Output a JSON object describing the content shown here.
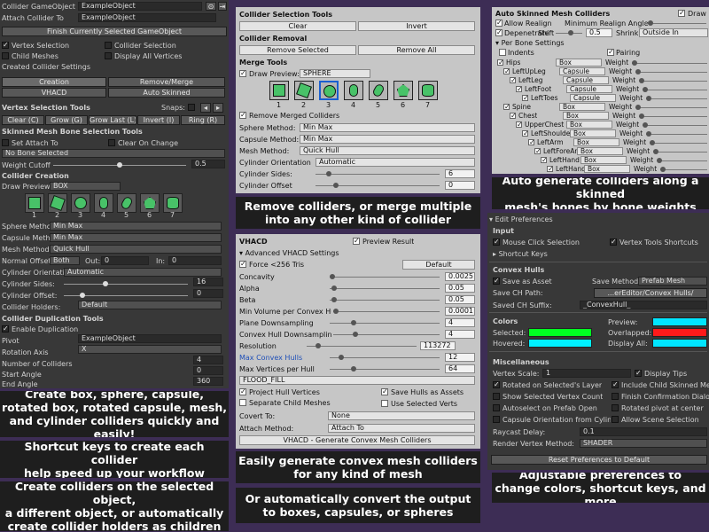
{
  "left": {
    "collider_go_label": "Collider GameObject",
    "collider_go_value": "ExampleObject",
    "attach_to_label": "Attach Collider To",
    "attach_to_value": "ExampleObject",
    "finish_btn": "Finish Currently Selected GameObject",
    "vertex_selection": "Vertex Selection",
    "collider_selection": "Collider Selection",
    "child_meshes": "Child Meshes",
    "display_all_vertices": "Display All Vertices",
    "created_settings": "Created Collider Settings",
    "tabs": [
      "Creation",
      "Remove/Merge",
      "VHACD",
      "Auto Skinned"
    ],
    "vertex_tools": "Vertex Selection Tools",
    "snaps_label": "Snaps:",
    "tool_buttons": [
      "Clear (C)",
      "Grow (G)",
      "Grow Last (L)",
      "Invert (I)",
      "Ring (R)"
    ],
    "skinned_tools": "Skinned Mesh Bone Selection Tools",
    "set_attach_to": "Set Attach To",
    "clear_on_change": "Clear On Change",
    "no_bone": "No Bone Selected",
    "weight_cutoff_label": "Weight Cutoff",
    "weight_cutoff_value": "0.5",
    "collider_creation": "Collider Creation",
    "draw_preview_label": "Draw Preview:",
    "draw_preview_value": "BOX",
    "shape_numbers": [
      "1",
      "2",
      "3",
      "4",
      "5",
      "6",
      "7"
    ],
    "fields": [
      {
        "label": "Sphere Method:",
        "value": "Min Max"
      },
      {
        "label": "Capsule Method:",
        "value": "Min Max"
      },
      {
        "label": "Mesh Method:",
        "value": "Quick Hull"
      }
    ],
    "normal_offset_label": "Normal Offset:",
    "normal_offset_value": "Both",
    "out_label": "Out:",
    "out_value": "0",
    "in_label": "In:",
    "in_value": "0",
    "orientation_label": "Cylinder Orientation:",
    "orientation_value": "Automatic",
    "cyl_sides_label": "Cylinder Sides:",
    "cyl_sides_value": "16",
    "cyl_offset_label": "Cylinder Offset:",
    "cyl_offset_value": "0",
    "holders_label": "Collider Holders:",
    "holders_value": "Default",
    "dup_tools": "Collider Duplication Tools",
    "enable_dup": "Enable Duplication",
    "pivot_label": "Pivot",
    "pivot_value": "ExampleObject",
    "rot_axis_label": "Rotation Axis",
    "rot_axis_value": "X",
    "num_colliders_label": "Number of Colliders",
    "num_colliders_value": "4",
    "start_angle_label": "Start Angle",
    "start_angle_value": "0",
    "end_angle_label": "End Angle",
    "end_angle_value": "360"
  },
  "captions": {
    "left1": "Create box, sphere, capsule,\nrotated box, rotated capsule, mesh,\nand cylinder colliders quickly and easily!",
    "left2": "Shortcut keys to create each collider\nhelp speed up your workflow",
    "left3": "Create colliders on the selected object,\na different object, or automatically\ncreate collider holders as children",
    "mid1": "Remove colliders, or merge multiple\ninto any other kind of collider",
    "mid2": "Easily generate convex mesh colliders\nfor any kind of mesh",
    "mid3": "Or automatically convert the output\nto boxes, capsules, or spheres",
    "right1": "Auto generate colliders along a skinned\nmesh's bones by bone weights",
    "right2": "Adjustable preferences to\nchange colors, shortcut keys, and more"
  },
  "remove": {
    "sel_tools": "Collider Selection Tools",
    "clear_btn": "Clear",
    "invert_btn": "Invert",
    "removal": "Collider Removal",
    "remove_selected": "Remove Selected",
    "remove_all": "Remove All",
    "merge_tools": "Merge Tools",
    "draw_preview_label": "Draw Preview:",
    "draw_preview_value": "SPHERE",
    "shape_numbers": [
      "1",
      "2",
      "3",
      "4",
      "5",
      "6",
      "7"
    ],
    "remove_merged": "Remove Merged Colliders",
    "fields": [
      {
        "label": "Sphere Method:",
        "value": "Min Max"
      },
      {
        "label": "Capsule Method:",
        "value": "Min Max"
      },
      {
        "label": "Mesh Method:",
        "value": "Quick Hull"
      },
      {
        "label": "Cylinder Orientation",
        "value": "Automatic"
      }
    ],
    "cyl_sides_label": "Cylinder Sides:",
    "cyl_sides_value": "6",
    "cyl_offset_label": "Cylinder Offset",
    "cyl_offset_value": "0"
  },
  "vhacd": {
    "title": "VHACD",
    "preview_result": "Preview Result",
    "advanced": "Advanced VHACD Settings",
    "force_label": "Force <256 Tris",
    "default_btn": "Default",
    "params": [
      {
        "label": "Concavity",
        "value": "0.0025"
      },
      {
        "label": "Alpha",
        "value": "0.05"
      },
      {
        "label": "Beta",
        "value": "0.05"
      },
      {
        "label": "Min Volume per Convex Hu",
        "value": "0.0001"
      },
      {
        "label": "Plane Downsampling",
        "value": "4"
      },
      {
        "label": "Convex Hull Downsampling",
        "value": "4"
      },
      {
        "label": "Resolution",
        "value": "113272"
      },
      {
        "label": "Max Convex Hulls",
        "value": "12"
      },
      {
        "label": "Max Vertices per Hull",
        "value": "64"
      }
    ],
    "fill_mode": "FLOOD_FILL",
    "project_hull": "Project Hull Vertices",
    "save_hulls": "Save Hulls as Assets",
    "separate_child": "Separate Child Meshes",
    "use_selected": "Use Selected Verts",
    "convert_label": "Covert To:",
    "convert_value": "None",
    "attach_label": "Attach Method:",
    "attach_value": "Attach To",
    "generate_btn": "VHACD - Generate Convex Mesh Colliders"
  },
  "auto": {
    "title": "Auto Skinned Mesh Colliders",
    "draw_label": "Draw P",
    "allow_realign": "Allow Realign",
    "min_realign": "Minimum Realign Angle",
    "depenetrate": "Depenetrate",
    "shift_label": "Shift",
    "shift_value": "0.5",
    "shrink_label": "Shrink",
    "shrink_value": "Outside In",
    "per_bone": "Per Bone Settings",
    "indents": "Indents",
    "pairing": "Pairing",
    "weight_label": "Weight",
    "bones": [
      {
        "name": "Hips",
        "type": "Box",
        "level": 0
      },
      {
        "name": "LeftUpLeg",
        "type": "Capsule",
        "level": 1
      },
      {
        "name": "LeftLeg",
        "type": "Capsule",
        "level": 2
      },
      {
        "name": "LeftFoot",
        "type": "Capsule",
        "level": 3
      },
      {
        "name": "LeftToes",
        "type": "Capsule",
        "level": 4
      },
      {
        "name": "Spine",
        "type": "Box",
        "level": 1
      },
      {
        "name": "Chest",
        "type": "Box",
        "level": 2
      },
      {
        "name": "UpperChest",
        "type": "Box",
        "level": 3
      },
      {
        "name": "LeftShoulder",
        "type": "Box",
        "level": 4
      },
      {
        "name": "LeftArm",
        "type": "Box",
        "level": 5
      },
      {
        "name": "LeftForeArm",
        "type": "Box",
        "level": 6
      },
      {
        "name": "LeftHand",
        "type": "Box",
        "level": 7
      },
      {
        "name": "LeftHandInd",
        "type": "Box",
        "level": 8
      }
    ]
  },
  "prefs": {
    "edit_prefs": "Edit Preferences",
    "input": "Input",
    "mouse_click": "Mouse Click Selection",
    "vertex_shortcuts": "Vertex Tools Shortcuts",
    "shortcut_keys": "Shortcut Keys",
    "convex_hulls": "Convex Hulls",
    "save_asset": "Save as Asset",
    "save_method_label": "Save Method",
    "save_method_value": "Prefab Mesh",
    "ch_path_label": "Save CH Path:",
    "ch_path_value": "...erEditor/Convex Hulls/",
    "ch_suffix_label": "Saved CH Suffix:",
    "ch_suffix_value": "_ConvexHull_",
    "colors": "Colors",
    "preview_label": "Preview:",
    "selected_label": "Selected:",
    "overlapped_label": "Overlapped:",
    "hovered_label": "Hovered:",
    "display_all_label": "Display All:",
    "color_values": {
      "preview": "#00e5ff",
      "selected": "#00ff22",
      "overlapped": "#ff1a1a",
      "hovered": "#00f0ff",
      "display_all": "#00e5ff"
    },
    "misc": "Miscellaneous",
    "vertex_scale_label": "Vertex Scale:",
    "vertex_scale_value": "1",
    "display_tips": "Display Tips",
    "rotated_on_layer": "Rotated on Selected's Layer",
    "include_child": "Include Child Skinned Mesh",
    "show_vertex_count": "Show Selected Vertex Count",
    "finish_confirm": "Finish Confirmation Dialog",
    "autoselect_prefab": "Autoselect on Prefab Open",
    "rotated_pivot": "Rotated pivot at center",
    "capsule_orient": "Capsule Orientation from Cylinde",
    "allow_scene": "Allow Scene Selection",
    "raycast_label": "Raycast Delay:",
    "raycast_value": "0.1",
    "render_method_label": "Render Vertex Method:",
    "render_method_value": "SHADER",
    "reset_btn": "Reset Preferences to Default"
  }
}
